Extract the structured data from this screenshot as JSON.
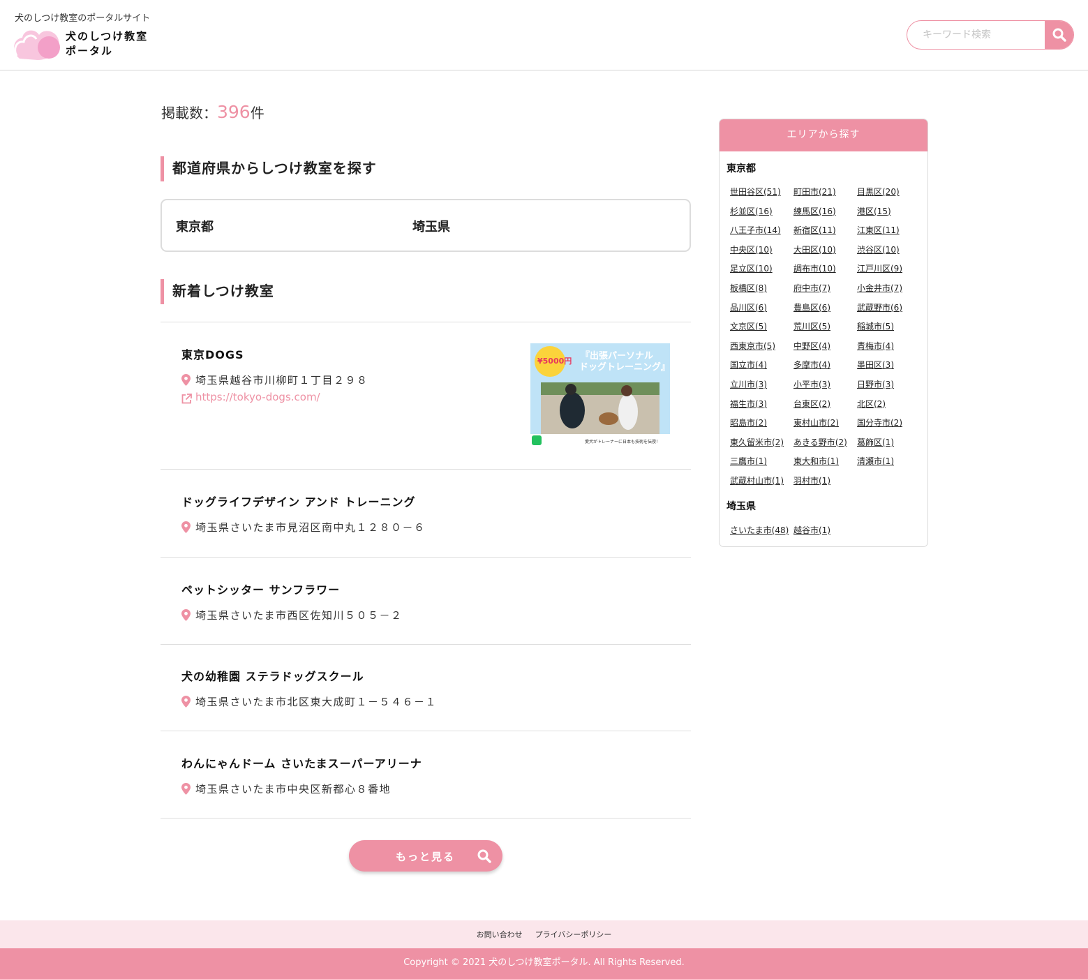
{
  "header": {
    "tagline": "犬のしつけ教室のポータルサイト",
    "logo_line1": "犬のしつけ教室",
    "logo_line2": "ポータル",
    "search_placeholder": "キーワード検索"
  },
  "count": {
    "label": "掲載数：",
    "value": "396",
    "unit": "件"
  },
  "prefecture_section": {
    "title": "都道府県からしつけ教室を探す",
    "prefectures": [
      "東京都",
      "埼玉県"
    ]
  },
  "new_section": {
    "title": "新着しつけ教室",
    "items": [
      {
        "name": "東京DOGS",
        "address": "埼玉県越谷市川柳町１丁目２９８",
        "url": "https://tokyo-dogs.com/",
        "thumb": {
          "price": "¥5000円",
          "headline1": "『出張パーソナル",
          "headline2": "ドッグトレーニング』",
          "caption": "愛犬がトレーナーに日本も技術を伝授！"
        }
      },
      {
        "name": "ドッグライフデザイン アンド トレーニング",
        "address": "埼玉県さいたま市見沼区南中丸１２８０－６"
      },
      {
        "name": "ペットシッター サンフラワー",
        "address": "埼玉県さいたま市西区佐知川５０５－２"
      },
      {
        "name": "犬の幼稚園 ステラドッグスクール",
        "address": "埼玉県さいたま市北区東大成町１－５４６－１"
      },
      {
        "name": "わんにゃんドーム さいたまスーパーアリーナ",
        "address": "埼玉県さいたま市中央区新都心８番地"
      }
    ],
    "more_label": "もっと見る"
  },
  "sidebar": {
    "title": "エリアから探す",
    "groups": [
      {
        "pref": "東京都",
        "areas": [
          "世田谷区(51)",
          "町田市(21)",
          "目黒区(20)",
          "杉並区(16)",
          "練馬区(16)",
          "港区(15)",
          "八王子市(14)",
          "新宿区(11)",
          "江東区(11)",
          "中央区(10)",
          "大田区(10)",
          "渋谷区(10)",
          "足立区(10)",
          "調布市(10)",
          "江戸川区(9)",
          "板橋区(8)",
          "府中市(7)",
          "小金井市(7)",
          "品川区(6)",
          "豊島区(6)",
          "武蔵野市(6)",
          "文京区(5)",
          "荒川区(5)",
          "稲城市(5)",
          "西東京市(5)",
          "中野区(4)",
          "青梅市(4)",
          "国立市(4)",
          "多摩市(4)",
          "墨田区(3)",
          "立川市(3)",
          "小平市(3)",
          "日野市(3)",
          "福生市(3)",
          "台東区(2)",
          "北区(2)",
          "昭島市(2)",
          "東村山市(2)",
          "国分寺市(2)",
          "東久留米市(2)",
          "あきる野市(2)",
          "葛飾区(1)",
          "三鷹市(1)",
          "東大和市(1)",
          "清瀬市(1)",
          "武蔵村山市(1)",
          "羽村市(1)"
        ]
      },
      {
        "pref": "埼玉県",
        "areas": [
          "さいたま市(48)",
          "越谷市(1)"
        ]
      }
    ]
  },
  "footer": {
    "links": [
      "お問い合わせ",
      "プライバシーポリシー"
    ],
    "copyright": "Copyright © 2021 犬のしつけ教室ポータル. All Rights Reserved."
  },
  "colors": {
    "accent": "#ee91a4",
    "footer_light": "#fbe6eb"
  },
  "icons": [
    "search-icon",
    "location-pin-icon",
    "external-link-icon"
  ]
}
